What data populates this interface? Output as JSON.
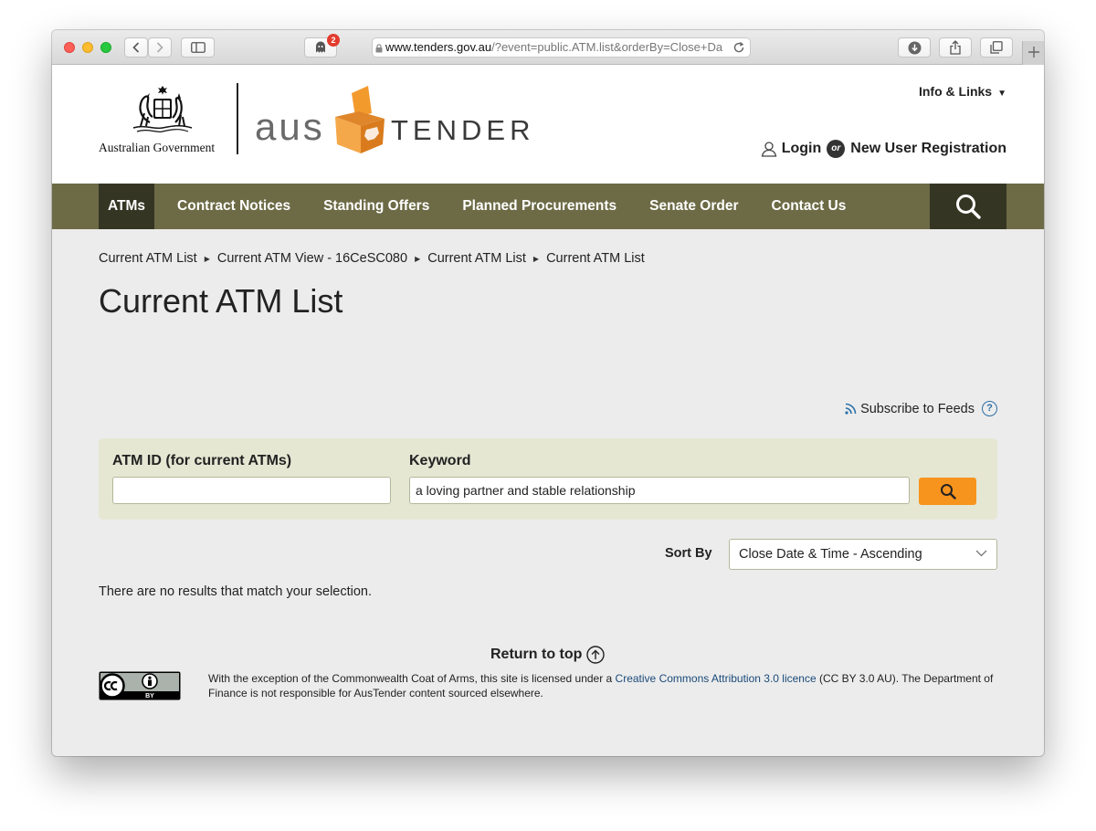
{
  "browser": {
    "url_host": "www.tenders.gov.au",
    "url_path": "/?event=public.ATM.list&orderBy=Close+Da",
    "ghostery_badge": "2"
  },
  "header": {
    "gov_name": "Australian Government",
    "brand_aus": "aus",
    "brand_tender": "TENDER",
    "info_links": "Info & Links",
    "login": "Login",
    "or": "or",
    "register": "New User Registration"
  },
  "nav": {
    "items": [
      "ATMs",
      "Contract Notices",
      "Standing Offers",
      "Planned Procurements",
      "Senate Order",
      "Contact Us"
    ],
    "active": "ATMs"
  },
  "breadcrumb": [
    "Current ATM List",
    "Current ATM View - 16CeSC080",
    "Current ATM List",
    "Current ATM List"
  ],
  "page_title": "Current ATM List",
  "subscribe": "Subscribe to Feeds",
  "search": {
    "atm_id_label": "ATM ID (for current ATMs)",
    "atm_id_value": "",
    "keyword_label": "Keyword",
    "keyword_value": "a loving partner and stable relationship"
  },
  "sort": {
    "label": "Sort By",
    "selected": "Close Date & Time - Ascending"
  },
  "results": {
    "message": "There are no results that match your selection."
  },
  "footer": {
    "return_top": "Return to top",
    "licence_pre": "With the exception of the Commonwealth Coat of Arms, this site is licensed under a ",
    "licence_link": "Creative Commons Attribution 3.0 licence",
    "licence_post": " (CC BY 3.0 AU). The Department of Finance is not responsible for AusTender content sourced elsewhere.",
    "cc_label": "BY"
  },
  "colors": {
    "nav_bg": "#6d6b46",
    "nav_active": "#353523",
    "search_panel": "#e5e7d3",
    "search_button": "#f7941d",
    "brand_orange": "#f39a2d"
  }
}
